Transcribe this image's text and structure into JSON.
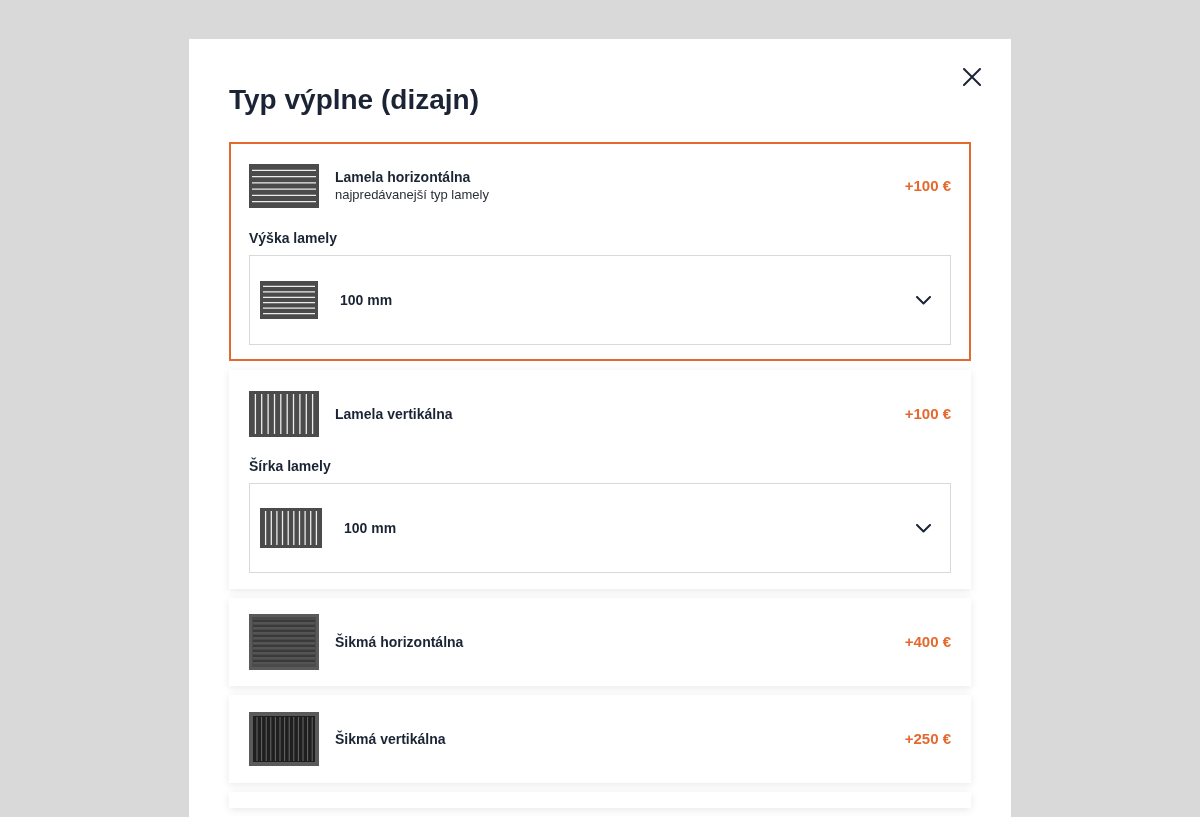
{
  "dialog": {
    "title": "Typ výplne (dizajn)"
  },
  "options": [
    {
      "kind": "horizontal",
      "name": "Lamela horizontálna",
      "description": "najpredávanejší typ lamely",
      "price": "+100 €",
      "selected": true,
      "setting": {
        "label": "Výška lamely",
        "value": "100 mm"
      }
    },
    {
      "kind": "vertical",
      "name": "Lamela vertikálna",
      "price": "+100 €",
      "selected": false,
      "setting": {
        "label": "Šírka lamely",
        "value": "100 mm"
      }
    },
    {
      "kind": "slanted-horizontal",
      "name": "Šikmá horizontálna",
      "price": "+400 €",
      "selected": false
    },
    {
      "kind": "slanted-vertical",
      "name": "Šikmá vertikálna",
      "price": "+250 €",
      "selected": false
    }
  ]
}
